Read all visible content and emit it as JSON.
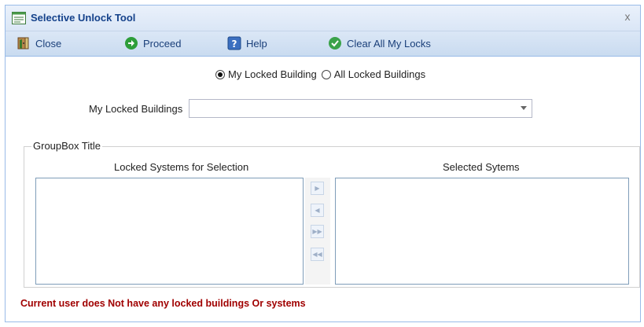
{
  "window": {
    "title": "Selective Unlock Tool",
    "close_glyph": "x"
  },
  "toolbar": {
    "close_label": "Close",
    "proceed_label": "Proceed",
    "help_label": "Help",
    "clear_label": "Clear All My Locks"
  },
  "radio": {
    "option1": "My Locked Building",
    "option2": "All Locked Buildings",
    "selected": "option1"
  },
  "locked_buildings": {
    "label": "My Locked Buildings",
    "value": ""
  },
  "groupbox": {
    "title": "GroupBox Title",
    "left_header": "Locked Systems for Selection",
    "right_header": "Selected Sytems",
    "left_items": [],
    "right_items": []
  },
  "move_buttons": {
    "add_glyph": "▶",
    "remove_glyph": "◀",
    "add_all_glyph": "▶▶",
    "remove_all_glyph": "◀◀"
  },
  "status": {
    "message": "Current user does Not have any locked buildings Or systems"
  },
  "colors": {
    "title_text": "#15428b",
    "status_text": "#a00000",
    "proceed_icon": "#2e9e3a",
    "clear_icon": "#3aa24a"
  },
  "icons": {
    "title": "form-window-icon",
    "close": "exit-door-icon",
    "proceed": "green-arrow-circle-icon",
    "help": "question-mark-icon",
    "clear": "green-check-circle-icon"
  }
}
